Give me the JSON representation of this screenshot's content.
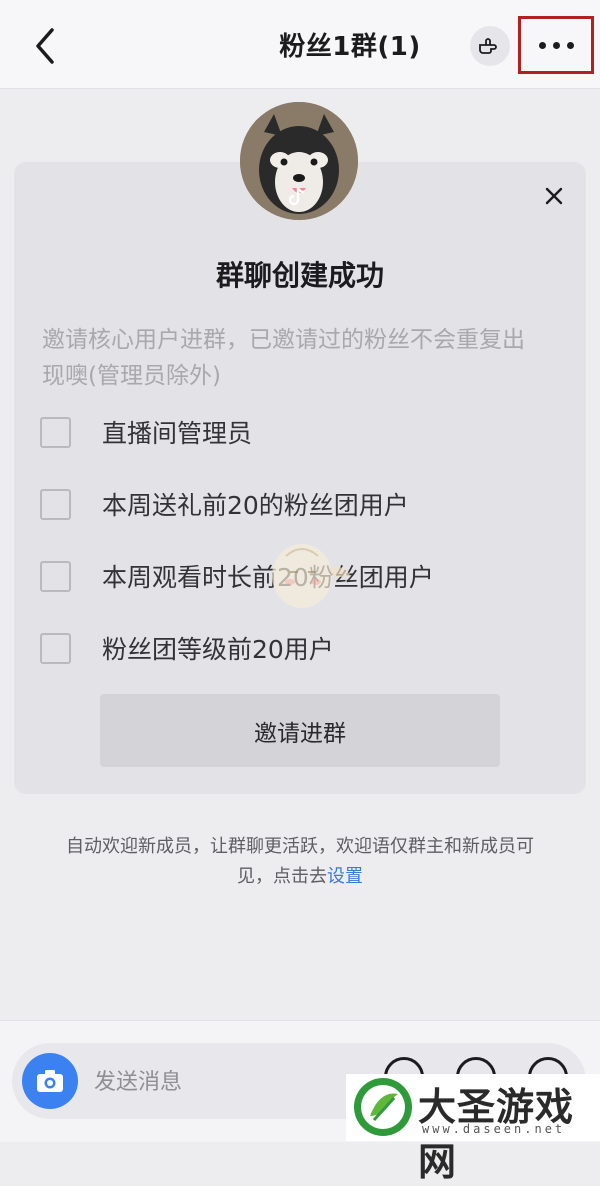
{
  "header": {
    "title": "粉丝1群(1)",
    "back_icon": "chevron-left-icon",
    "hand_icon": "pointing-hand-icon",
    "more_icon": "ellipsis-icon",
    "highlight_color": "#b3201f"
  },
  "card": {
    "title": "群聊创建成功",
    "description": "邀请核心用户进群，已邀请过的粉丝不会重复出现噢(管理员除外)",
    "options": [
      {
        "label": "直播间管理员",
        "checked": false
      },
      {
        "label": "本周送礼前20的粉丝团用户",
        "checked": false
      },
      {
        "label": "本周观看时长前20粉丝团用户",
        "checked": false
      },
      {
        "label": "粉丝团等级前20用户",
        "checked": false
      }
    ],
    "invite_button": "邀请进群"
  },
  "note": {
    "text": "自动欢迎新成员，让群聊更活跃，欢迎语仅群主和新成员可见，点击去",
    "link": "设置",
    "link_color": "#3c7ad6"
  },
  "composer": {
    "placeholder": "发送消息",
    "accent": "#3b82f0"
  },
  "watermark": {
    "name": "大圣游戏网",
    "url": "www.daseen.net"
  }
}
